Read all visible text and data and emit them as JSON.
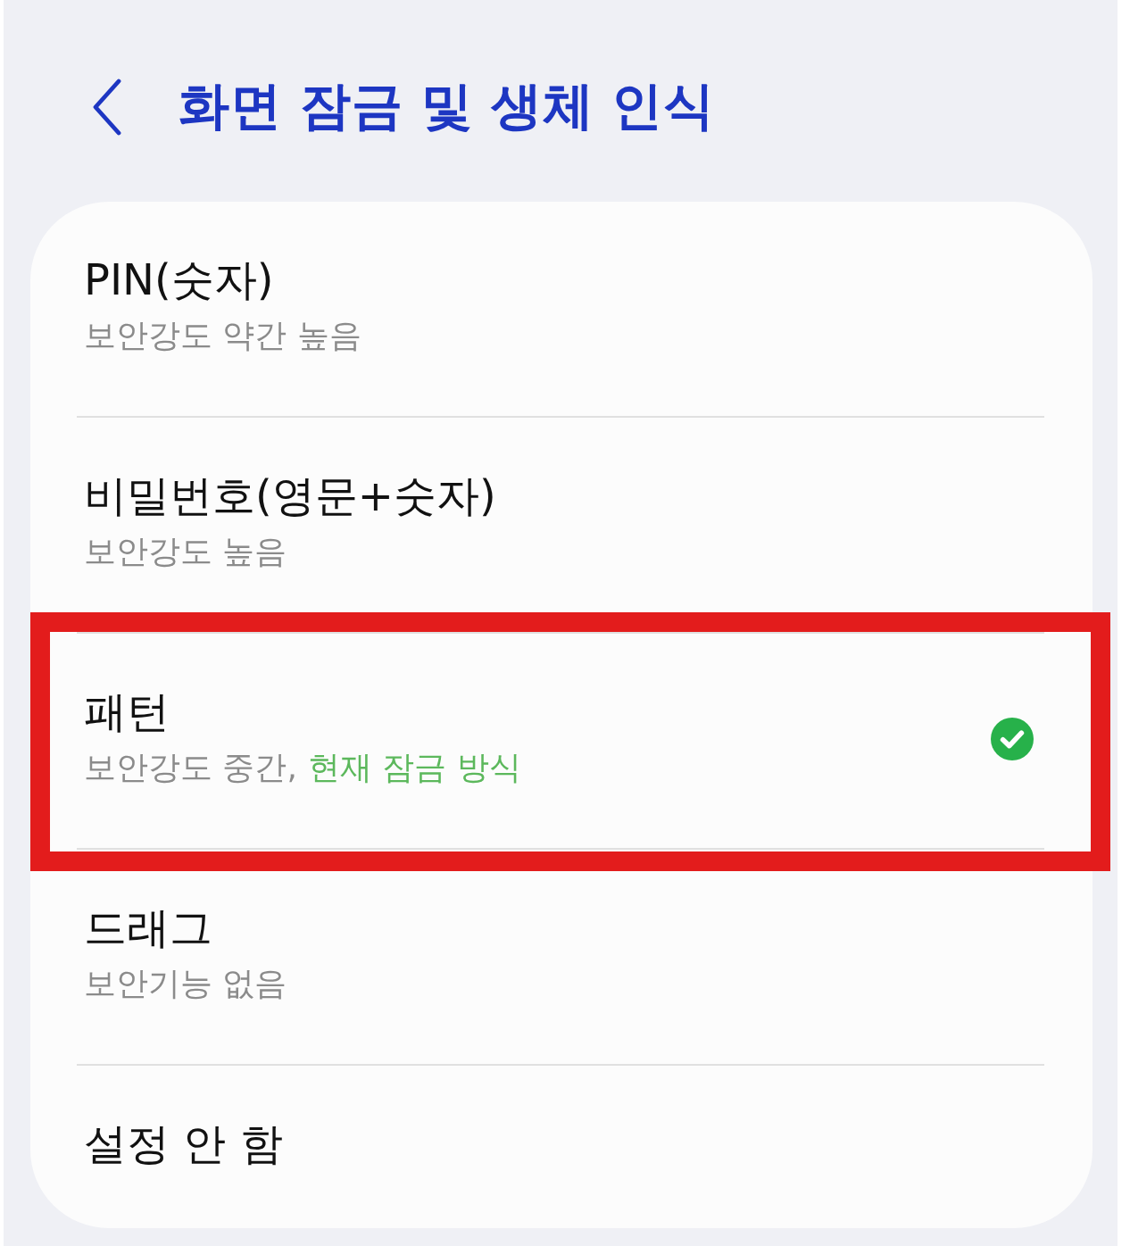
{
  "header": {
    "title": "화면 잠금 및 생체 인식"
  },
  "options": [
    {
      "title": "PIN(숫자)",
      "subtitle": "보안강도 약간 높음",
      "selected": false,
      "highlighted": false
    },
    {
      "title": "비밀번호(영문+숫자)",
      "subtitle": "보안강도 높음",
      "selected": false,
      "highlighted": false
    },
    {
      "title": "패턴",
      "subtitle": "보안강도 중간,",
      "status": "현재 잠금 방식",
      "selected": true,
      "highlighted": true
    },
    {
      "title": "드래그",
      "subtitle": "보안기능 없음",
      "selected": false,
      "highlighted": false
    },
    {
      "title": "설정 안 함",
      "selected": false,
      "highlighted": false
    }
  ]
}
